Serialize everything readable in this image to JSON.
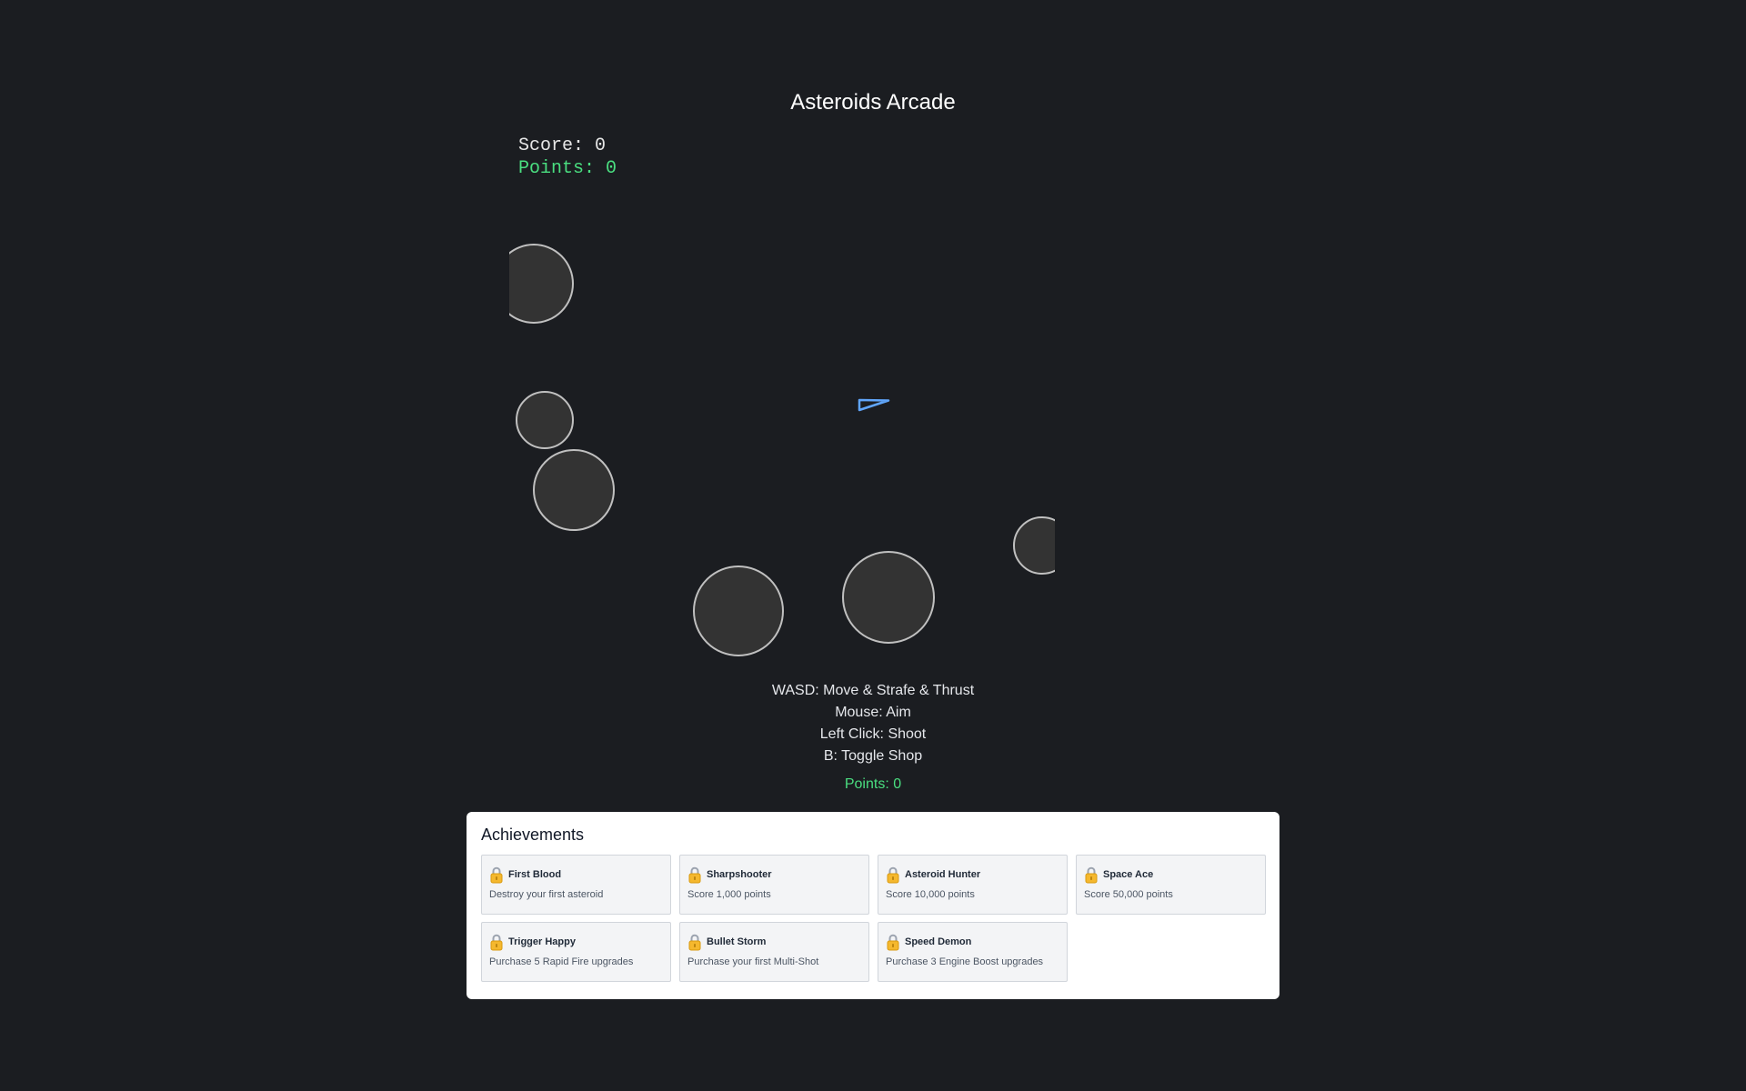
{
  "app": {
    "title": "Asteroids Arcade"
  },
  "hud": {
    "score_text": "Score: 0",
    "points_text": "Points: 0"
  },
  "ship": {
    "icon": "ship-triangle-icon",
    "color": "#60a5fa"
  },
  "asteroids": {
    "count": 7,
    "fill": "#333333",
    "stroke": "#c0c0c0"
  },
  "controls": [
    "WASD: Move & Strafe & Thrust",
    "Mouse: Aim",
    "Left Click: Shoot",
    "B: Toggle Shop"
  ],
  "points_below": "Points: 0",
  "achievements": {
    "title": "Achievements",
    "items": [
      {
        "icon": "lock-icon",
        "name": "First Blood",
        "description": "Destroy your first asteroid"
      },
      {
        "icon": "lock-icon",
        "name": "Sharpshooter",
        "description": "Score 1,000 points"
      },
      {
        "icon": "lock-icon",
        "name": "Asteroid Hunter",
        "description": "Score 10,000 points"
      },
      {
        "icon": "lock-icon",
        "name": "Space Ace",
        "description": "Score 50,000 points"
      },
      {
        "icon": "lock-icon",
        "name": "Trigger Happy",
        "description": "Purchase 5 Rapid Fire upgrades"
      },
      {
        "icon": "lock-icon",
        "name": "Bullet Storm",
        "description": "Purchase your first Multi-Shot"
      },
      {
        "icon": "lock-icon",
        "name": "Speed Demon",
        "description": "Purchase 3 Engine Boost upgrades"
      }
    ]
  },
  "colors": {
    "background": "#1b1d21",
    "accent_green": "#4ade80",
    "ship_blue": "#60a5fa"
  }
}
